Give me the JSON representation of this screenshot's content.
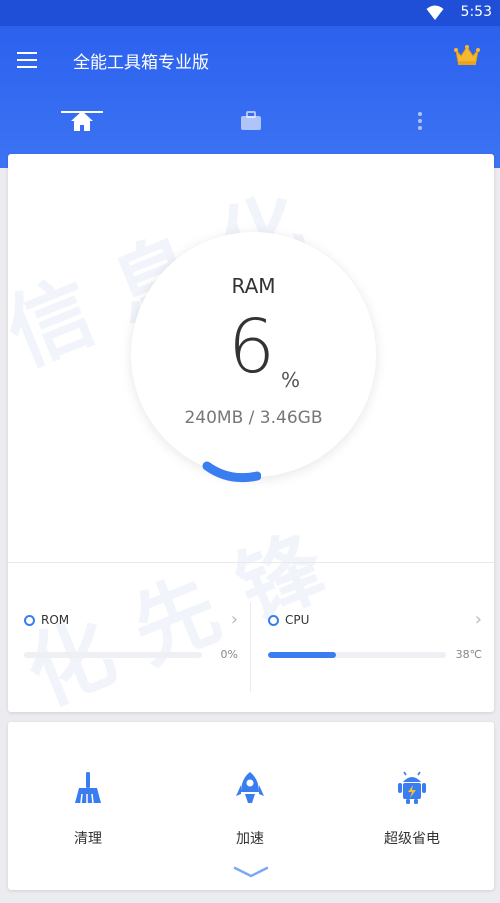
{
  "status_bar": {
    "time": "5:53",
    "wifi_icon": "wifi-icon"
  },
  "app_bar": {
    "title": "全能工具箱专业版",
    "menu_icon": "menu-icon",
    "vip_icon": "crown-icon"
  },
  "tabs": [
    {
      "icon": "home-icon",
      "selected": true
    },
    {
      "icon": "briefcase-icon",
      "selected": false
    },
    {
      "icon": "more-vert-icon",
      "selected": false
    }
  ],
  "ram": {
    "label": "RAM",
    "percent": "6",
    "percent_sign": "%",
    "detail": "240MB / 3.46GB",
    "usage_fraction": 0.06
  },
  "stats": {
    "rom": {
      "label": "ROM",
      "value": "0%",
      "fill_fraction": 0
    },
    "cpu": {
      "label": "CPU",
      "value": "38℃",
      "fill_fraction": 0.38
    }
  },
  "actions": [
    {
      "label": "清理",
      "icon": "broom-icon"
    },
    {
      "label": "加速",
      "icon": "rocket-icon"
    },
    {
      "label": "超级省电",
      "icon": "android-battery-icon"
    }
  ],
  "watermark": "信息化先锋",
  "colors": {
    "primary": "#2b61ee",
    "accent": "#3a7df0"
  }
}
